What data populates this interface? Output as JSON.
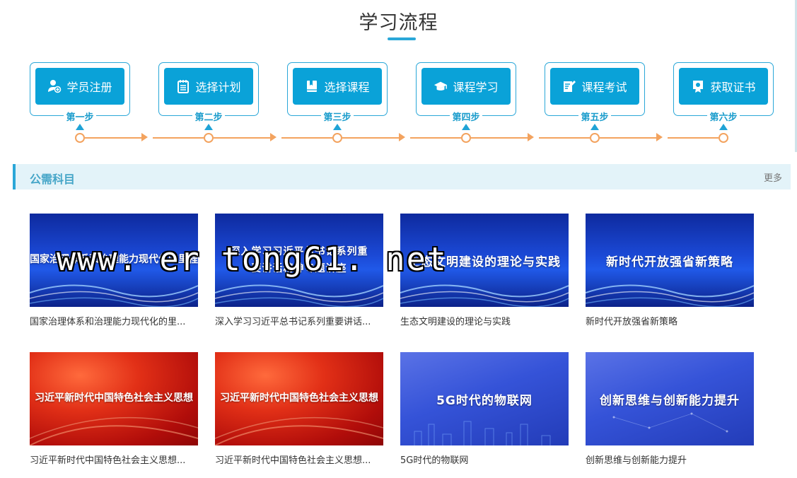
{
  "page_title": "学习流程",
  "steps": [
    {
      "label": "学员注册",
      "step": "第一步",
      "icon": "user-add-icon"
    },
    {
      "label": "选择计划",
      "step": "第二步",
      "icon": "notepad-icon"
    },
    {
      "label": "选择课程",
      "step": "第三步",
      "icon": "book-icon"
    },
    {
      "label": "课程学习",
      "step": "第四步",
      "icon": "graduation-cap-icon"
    },
    {
      "label": "课程考试",
      "step": "第五步",
      "icon": "exam-pen-icon"
    },
    {
      "label": "获取证书",
      "step": "第六步",
      "icon": "certificate-icon"
    }
  ],
  "section": {
    "title": "公需科目",
    "more": "更多"
  },
  "courses": [
    {
      "thumb_text": "国家治理体系和治理能力现代化的里程碑",
      "caption": "国家治理体系和治理能力现代化的里...",
      "theme": "blue"
    },
    {
      "thumb_text": "深入学习习近平总书记系列重要讲话精神专题讲座",
      "caption": "深入学习习近平总书记系列重要讲话...",
      "theme": "blue"
    },
    {
      "thumb_text": "生态文明建设的理论与实践",
      "caption": "生态文明建设的理论与实践",
      "theme": "blue"
    },
    {
      "thumb_text": "新时代开放强省新策略",
      "caption": "新时代开放强省新策略",
      "theme": "blue"
    },
    {
      "thumb_text": "习近平新时代中国特色社会主义思想",
      "caption": "习近平新时代中国特色社会主义思想...",
      "theme": "red"
    },
    {
      "thumb_text": "习近平新时代中国特色社会主义思想",
      "caption": "习近平新时代中国特色社会主义思想...",
      "theme": "red"
    },
    {
      "thumb_text": "5G时代的物联网",
      "caption": "5G时代的物联网",
      "theme": "violet"
    },
    {
      "thumb_text": "创新思维与创新能力提升",
      "caption": "创新思维与创新能力提升",
      "theme": "violet"
    }
  ],
  "watermark": "www. er tong61. net",
  "colors": {
    "accent": "#0aa2d8",
    "timeline": "#f3a35f",
    "section_bg": "#e3f3f9"
  }
}
